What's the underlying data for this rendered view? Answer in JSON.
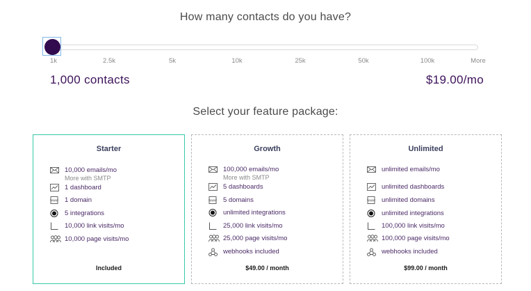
{
  "question": "How many contacts do you have?",
  "slider": {
    "value_fraction": 0,
    "ticks": [
      "1k",
      "2.5k",
      "5k",
      "10k",
      "25k",
      "50k",
      "100k",
      "More"
    ]
  },
  "summary": {
    "contacts": "1,000  contacts",
    "price": "$19.00/mo"
  },
  "package_question": "Select your feature package:",
  "colors": {
    "accent_purple": "#3d1259",
    "selected_border": "#35c9a9",
    "handle": "#320a4e"
  },
  "cards": [
    {
      "title": "Starter",
      "features": [
        {
          "icon": "envelope-icon",
          "text": "10,000 emails/mo",
          "sub": "More with SMTP"
        },
        {
          "icon": "dashboard-icon",
          "text": "1 dashboard"
        },
        {
          "icon": "domain-icon",
          "text": "1 domain"
        },
        {
          "icon": "integration-icon",
          "text": "5 integrations"
        },
        {
          "icon": "link-icon",
          "text": "10,000 link visits/mo"
        },
        {
          "icon": "people-icon",
          "text": "10,000 page visits/mo"
        }
      ],
      "footer": "Included"
    },
    {
      "title": "Growth",
      "features": [
        {
          "icon": "envelope-icon",
          "text": "100,000 emails/mo",
          "sub": "More with SMTP"
        },
        {
          "icon": "dashboard-icon",
          "text": "5 dashboards"
        },
        {
          "icon": "domain-icon",
          "text": "5 domains"
        },
        {
          "icon": "integration-icon",
          "text": "unlimited integrations"
        },
        {
          "icon": "link-icon",
          "text": "25,000 link visits/mo"
        },
        {
          "icon": "people-icon",
          "text": "25,000 page visits/mo"
        },
        {
          "icon": "webhook-icon",
          "text": "webhooks included"
        }
      ],
      "footer": "$49.00 / month"
    },
    {
      "title": "Unlimited",
      "features": [
        {
          "icon": "envelope-icon",
          "text": "unlimited emails/mo"
        },
        {
          "icon": "dashboard-icon",
          "text": "unlimited dashboards"
        },
        {
          "icon": "domain-icon",
          "text": "unlimited domains"
        },
        {
          "icon": "integration-icon",
          "text": "unlimited integrations"
        },
        {
          "icon": "link-icon",
          "text": "100,000 link visits/mo"
        },
        {
          "icon": "people-icon",
          "text": "100,000 page visits/mo"
        },
        {
          "icon": "webhook-icon",
          "text": "webhooks included"
        }
      ],
      "footer": "$99.00 / month"
    }
  ]
}
